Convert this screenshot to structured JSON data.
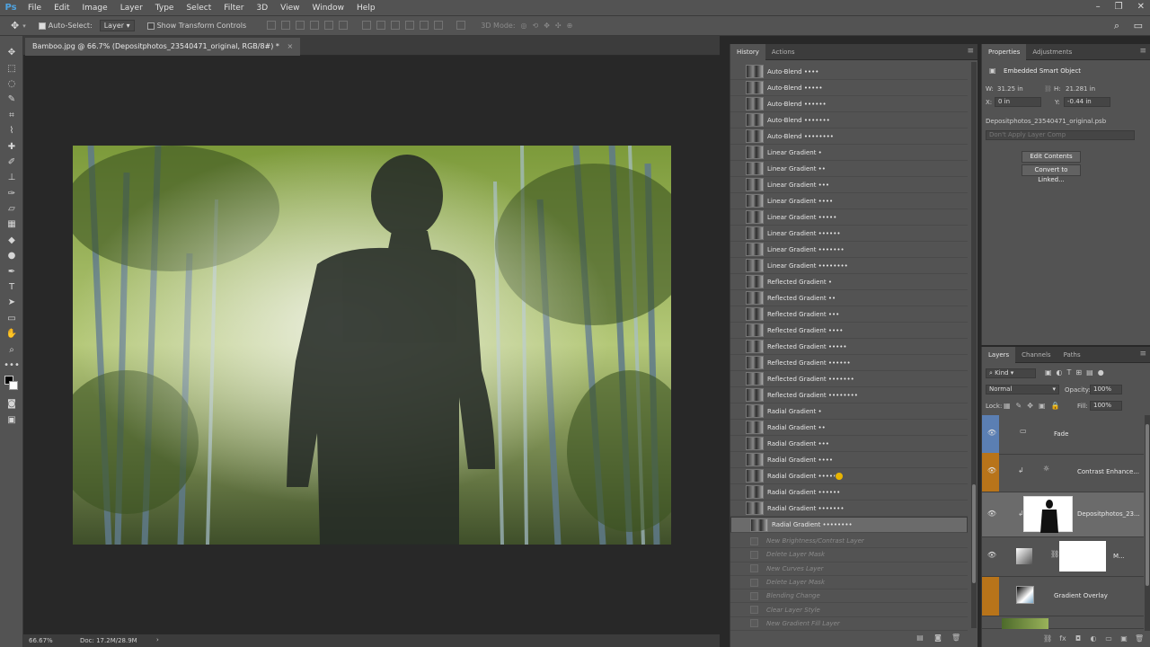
{
  "menu": {
    "logo": "Ps",
    "items": [
      "File",
      "Edit",
      "Image",
      "Layer",
      "Type",
      "Select",
      "Filter",
      "3D",
      "View",
      "Window",
      "Help"
    ]
  },
  "options": {
    "auto_select_label": "Auto-Select:",
    "auto_select_value": "Layer",
    "show_transform_label": "Show Transform Controls",
    "mode_3d_label": "3D Mode:"
  },
  "document": {
    "tab_title": "Bamboo.jpg @ 66.7% (Depositphotos_23540471_original, RGB/8#) *",
    "zoom": "66.67%",
    "doc_size": "Doc: 17.2M/28.9M"
  },
  "history": {
    "tabs": [
      "History",
      "Actions"
    ],
    "items": [
      "Auto-Blend ••••",
      "Auto-Blend •••••",
      "Auto-Blend ••••••",
      "Auto-Blend •••••••",
      "Auto-Blend ••••••••",
      "Linear Gradient •",
      "Linear Gradient ••",
      "Linear Gradient •••",
      "Linear Gradient ••••",
      "Linear Gradient •••••",
      "Linear Gradient ••••••",
      "Linear Gradient •••••••",
      "Linear Gradient ••••••••",
      "Reflected Gradient •",
      "Reflected Gradient ••",
      "Reflected Gradient •••",
      "Reflected Gradient ••••",
      "Reflected Gradient •••••",
      "Reflected Gradient ••••••",
      "Reflected Gradient •••••••",
      "Reflected Gradient ••••••••",
      "Radial Gradient •",
      "Radial Gradient ••",
      "Radial Gradient •••",
      "Radial Gradient ••••",
      "Radial Gradient •••••",
      "Radial Gradient ••••••",
      "Radial Gradient •••••••",
      "Radial Gradient ••••••••"
    ],
    "ghost_items": [
      "New Brightness/Contrast Layer",
      "Delete Layer Mask",
      "New Curves Layer",
      "Delete Layer Mask",
      "Blending Change",
      "Clear Layer Style",
      "New Gradient Fill Layer"
    ]
  },
  "properties": {
    "tabs": [
      "Properties",
      "Adjustments"
    ],
    "title": "Embedded Smart Object",
    "w_label": "W:",
    "w_value": "31.25 in",
    "h_label": "H:",
    "h_value": "21.281 in",
    "x_label": "X:",
    "x_value": "0 in",
    "y_label": "Y:",
    "y_value": "-0.44 in",
    "filename": "Depositphotos_23540471_original.psb",
    "layer_comp": "Don't Apply Layer Comp",
    "edit_contents": "Edit Contents",
    "convert_linked": "Convert to Linked..."
  },
  "layers": {
    "tabs": [
      "Layers",
      "Channels",
      "Paths"
    ],
    "kind": "Kind",
    "blend_mode": "Normal",
    "opacity_label": "Opacity:",
    "opacity_value": "100%",
    "lock_label": "Lock:",
    "fill_label": "Fill:",
    "fill_value": "100%",
    "rows": [
      {
        "name": "Fade",
        "color": "#5b7fb3"
      },
      {
        "name": "Contrast Enhance...",
        "color": "#b8741a"
      },
      {
        "name": "Depositphotos_23...",
        "color": ""
      },
      {
        "name": "M...",
        "color": ""
      },
      {
        "name": "Gradient Overlay",
        "color": "#b8741a"
      }
    ]
  }
}
